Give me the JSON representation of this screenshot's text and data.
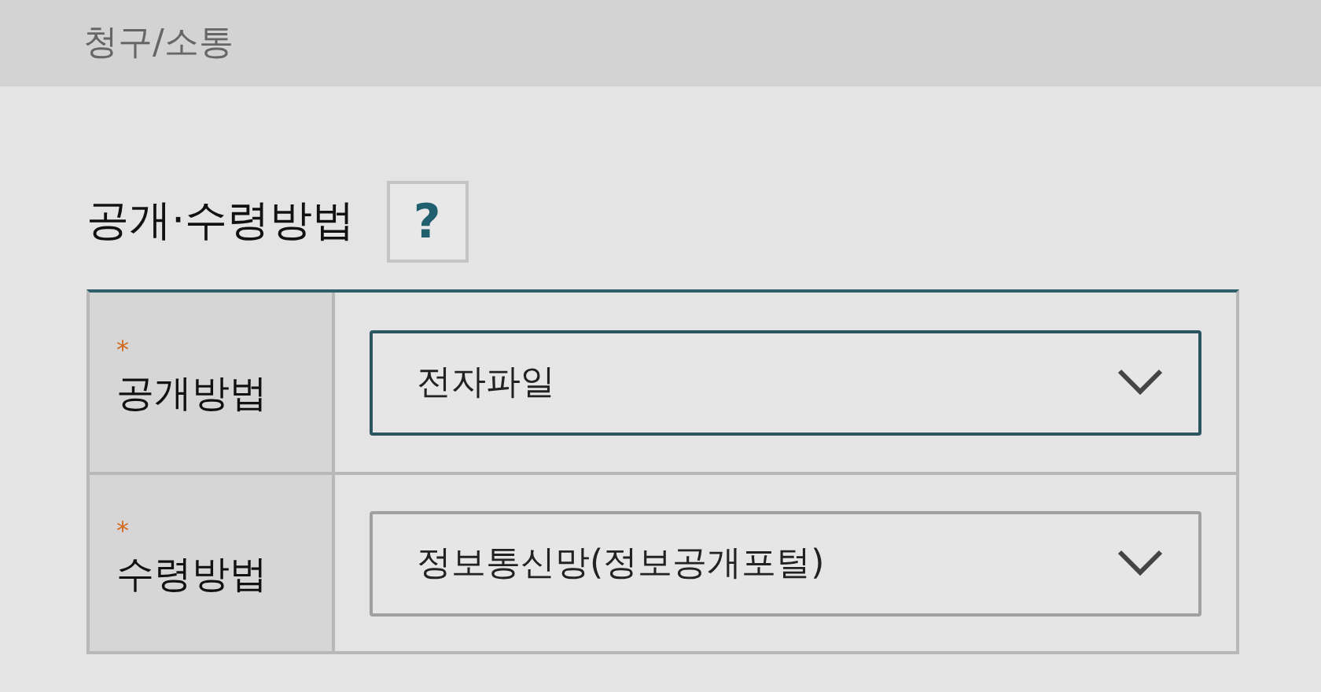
{
  "header": {
    "title": "청구/소통"
  },
  "section": {
    "title": "공개·수령방법",
    "help": "?"
  },
  "fields": [
    {
      "label": "공개방법",
      "required_mark": "*",
      "value": "전자파일",
      "focused": true
    },
    {
      "label": "수령방법",
      "required_mark": "*",
      "value": "정보통신망(정보공개포털)",
      "focused": false
    }
  ]
}
